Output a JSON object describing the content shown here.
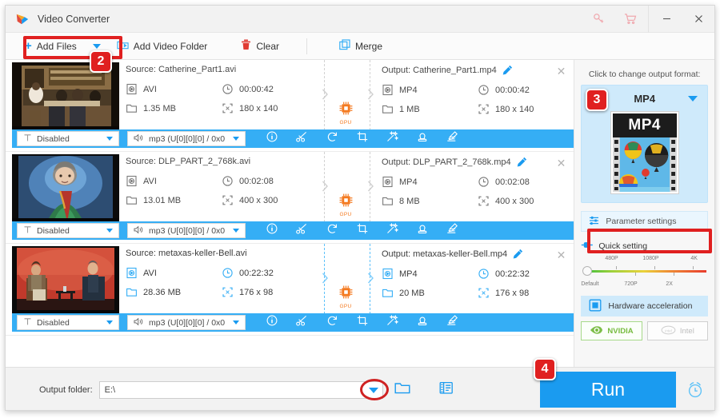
{
  "window": {
    "title": "Video Converter",
    "logo_icon": "play-triangle-logo",
    "controls": [
      {
        "name": "key-icon",
        "glyph": "key"
      },
      {
        "name": "cart-icon",
        "glyph": "cart"
      },
      {
        "name": "minimize-button",
        "glyph": "minimize"
      },
      {
        "name": "close-button",
        "glyph": "close"
      }
    ]
  },
  "toolbar": {
    "add_files": "Add Files",
    "add_files_icon": "plus-icon",
    "dropdown_icon": "caret-down-icon",
    "add_video_folder": "Add Video Folder",
    "add_video_folder_icon": "folder-video-icon",
    "clear": "Clear",
    "clear_icon": "trash-icon",
    "merge": "Merge",
    "merge_icon": "merge-squares-icon"
  },
  "labels": {
    "source_prefix": "Source: ",
    "output_prefix": "Output: ",
    "gpu": "GPU"
  },
  "files": [
    {
      "selected": false,
      "thumb": "kitchen-class",
      "source_name": "Source: Catherine_Part1.avi",
      "source_format": "AVI",
      "source_duration": "00:00:42",
      "source_size": "1.35 MB",
      "source_resolution": "180 x 140",
      "output_name": "Output: Catherine_Part1.mp4",
      "output_format": "MP4",
      "output_duration": "00:00:42",
      "output_size": "1 MB",
      "output_resolution": "180 x 140",
      "subtitle": "Disabled",
      "audio": "mp3 (U[0][0][0] / 0x0"
    },
    {
      "selected": false,
      "thumb": "woman-green",
      "source_name": "Source: DLP_PART_2_768k.avi",
      "source_format": "AVI",
      "source_duration": "00:02:08",
      "source_size": "13.01 MB",
      "source_resolution": "400 x 300",
      "output_name": "Output: DLP_PART_2_768k.mp4",
      "output_format": "MP4",
      "output_duration": "00:02:08",
      "output_size": "8 MB",
      "output_resolution": "400 x 300",
      "subtitle": "Disabled",
      "audio": "mp3 (U[0][0][0] / 0x0"
    },
    {
      "selected": true,
      "thumb": "interview-stage",
      "source_name": "Source: metaxas-keller-Bell.avi",
      "source_format": "AVI",
      "source_duration": "00:22:32",
      "source_size": "28.36 MB",
      "source_resolution": "176 x 98",
      "output_name": "Output: metaxas-keller-Bell.mp4",
      "output_format": "MP4",
      "output_duration": "00:22:32",
      "output_size": "20 MB",
      "output_resolution": "176 x 98",
      "subtitle": "Disabled",
      "audio": "mp3 (U[0][0][0] / 0x0"
    }
  ],
  "row_action_icons": [
    {
      "name": "info-icon"
    },
    {
      "name": "cut-scissors-icon"
    },
    {
      "name": "rotate-icon"
    },
    {
      "name": "crop-icon"
    },
    {
      "name": "effect-wand-icon"
    },
    {
      "name": "watermark-stamp-icon"
    },
    {
      "name": "subtitle-edit-icon"
    }
  ],
  "sidebar": {
    "hint": "Click to change output format:",
    "format_name": "MP4",
    "format_badge": "MP4",
    "parameter_settings": "Parameter settings",
    "parameter_icon": "sliders-icon",
    "quick_setting": "Quick setting",
    "quick_setting_icon": "slider-handle-icon",
    "slider_top_labels": [
      "480P",
      "1080P",
      "4K"
    ],
    "slider_bottom_labels": [
      "Default",
      "720P",
      "2X"
    ],
    "slider_value": "Default",
    "hardware_acceleration": "Hardware acceleration",
    "hardware_icon": "chip-square-icon",
    "vendors": [
      {
        "name": "NVIDIA",
        "icon": "nvidia-eye-icon",
        "enabled": true
      },
      {
        "name": "Intel",
        "icon": "intel-oval-icon",
        "enabled": false
      }
    ]
  },
  "bottom": {
    "output_folder_label": "Output folder:",
    "output_folder_value": "E:\\",
    "output_folder_placeholder": "E:\\",
    "dropdown_icon": "caret-down-icon",
    "browse_icon": "folder-open-icon",
    "preview_icon": "media-list-icon",
    "run_label": "Run",
    "alarm_icon": "alarm-clock-icon"
  },
  "annotations": {
    "badge2": "2",
    "badge3": "3",
    "badge4": "4"
  },
  "colors": {
    "accent": "#1a9bf0",
    "action_bar": "#35aef5",
    "annotation": "#e02020",
    "gpu_orange": "#f47a20",
    "nvidia_green": "#76bb3f"
  }
}
